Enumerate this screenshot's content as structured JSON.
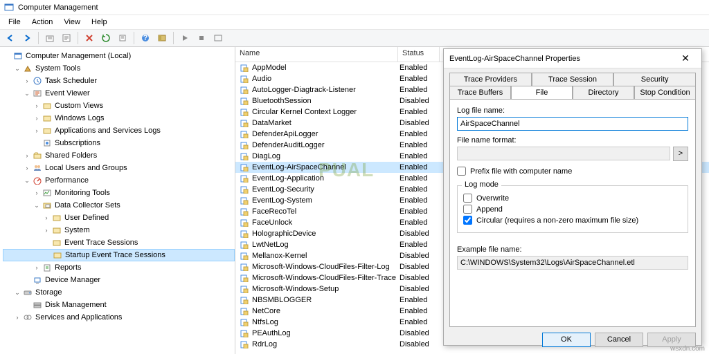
{
  "window": {
    "title": "Computer Management"
  },
  "menu": [
    "File",
    "Action",
    "View",
    "Help"
  ],
  "tree": {
    "root": "Computer Management (Local)",
    "systools": "System Tools",
    "tasksched": "Task Scheduler",
    "eventviewer": "Event Viewer",
    "customviews": "Custom Views",
    "winlogs": "Windows Logs",
    "appsvclogs": "Applications and Services Logs",
    "subs": "Subscriptions",
    "sharedfolders": "Shared Folders",
    "localusers": "Local Users and Groups",
    "perf": "Performance",
    "montools": "Monitoring Tools",
    "dcs": "Data Collector Sets",
    "userdef": "User Defined",
    "system": "System",
    "ets": "Event Trace Sessions",
    "sets": "Startup Event Trace Sessions",
    "reports": "Reports",
    "devmgr": "Device Manager",
    "storage": "Storage",
    "diskmgmt": "Disk Management",
    "svcapps": "Services and Applications"
  },
  "list": {
    "col1": "Name",
    "col2": "Status",
    "rows": [
      {
        "n": "AppModel",
        "s": "Enabled"
      },
      {
        "n": "Audio",
        "s": "Enabled"
      },
      {
        "n": "AutoLogger-Diagtrack-Listener",
        "s": "Enabled"
      },
      {
        "n": "BluetoothSession",
        "s": "Disabled"
      },
      {
        "n": "Circular Kernel Context Logger",
        "s": "Enabled"
      },
      {
        "n": "DataMarket",
        "s": "Disabled"
      },
      {
        "n": "DefenderApiLogger",
        "s": "Enabled"
      },
      {
        "n": "DefenderAuditLogger",
        "s": "Enabled"
      },
      {
        "n": "DiagLog",
        "s": "Enabled"
      },
      {
        "n": "EventLog-AirSpaceChannel",
        "s": "Enabled",
        "sel": true
      },
      {
        "n": "EventLog-Application",
        "s": "Enabled"
      },
      {
        "n": "EventLog-Security",
        "s": "Enabled"
      },
      {
        "n": "EventLog-System",
        "s": "Enabled"
      },
      {
        "n": "FaceRecoTel",
        "s": "Enabled"
      },
      {
        "n": "FaceUnlock",
        "s": "Enabled"
      },
      {
        "n": "HolographicDevice",
        "s": "Disabled"
      },
      {
        "n": "LwtNetLog",
        "s": "Enabled"
      },
      {
        "n": "Mellanox-Kernel",
        "s": "Disabled"
      },
      {
        "n": "Microsoft-Windows-CloudFiles-Filter-Log",
        "s": "Disabled"
      },
      {
        "n": "Microsoft-Windows-CloudFiles-Filter-Trace",
        "s": "Disabled"
      },
      {
        "n": "Microsoft-Windows-Setup",
        "s": "Disabled"
      },
      {
        "n": "NBSMBLOGGER",
        "s": "Enabled"
      },
      {
        "n": "NetCore",
        "s": "Enabled"
      },
      {
        "n": "NtfsLog",
        "s": "Enabled"
      },
      {
        "n": "PEAuthLog",
        "s": "Disabled"
      },
      {
        "n": "RdrLog",
        "s": "Disabled"
      }
    ]
  },
  "dialog": {
    "title": "EventLog-AirSpaceChannel Properties",
    "tabs": {
      "tp": "Trace Providers",
      "ts": "Trace Session",
      "sec": "Security",
      "tb": "Trace Buffers",
      "file": "File",
      "dir": "Directory",
      "sc": "Stop Condition"
    },
    "logfilename_lbl": "Log file name:",
    "logfilename": "AirSpaceChannel",
    "fmt_lbl": "File name format:",
    "fmtbtn": ">",
    "prefix": "Prefix file with computer name",
    "logmode": "Log mode",
    "overwrite": "Overwrite",
    "append": "Append",
    "circular": "Circular (requires a non-zero maximum file size)",
    "example_lbl": "Example file name:",
    "example": "C:\\WINDOWS\\System32\\Logs\\AirSpaceChannel.etl",
    "ok": "OK",
    "cancel": "Cancel",
    "apply": "Apply"
  },
  "watermark": "PUAL",
  "footer": "wsxdn.com"
}
